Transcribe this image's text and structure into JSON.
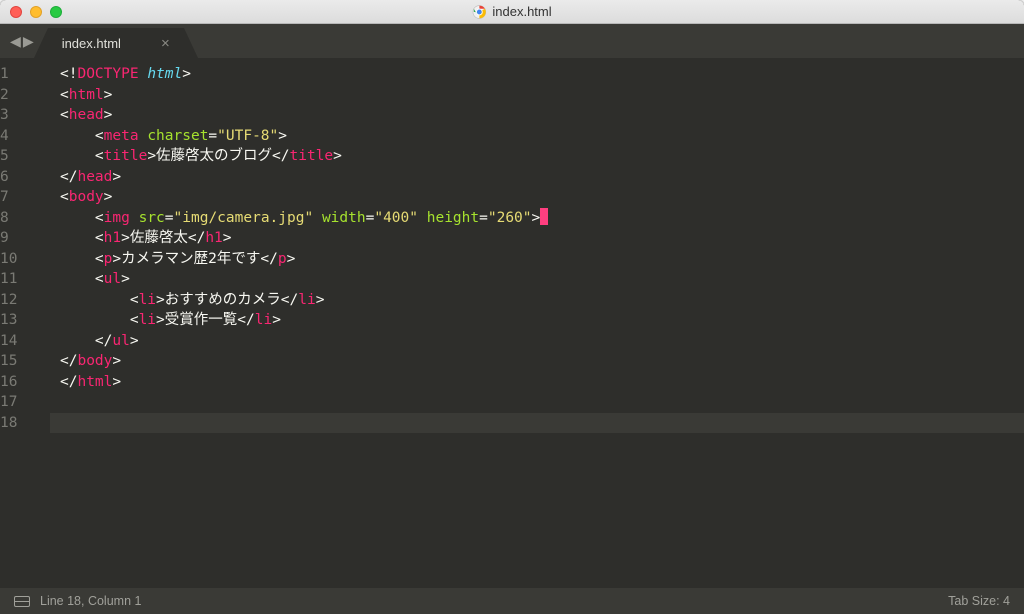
{
  "window": {
    "title": "index.html"
  },
  "tab": {
    "label": "index.html",
    "close": "×"
  },
  "nav": {
    "back": "◀",
    "forward": "▶"
  },
  "gutter": {
    "numbers": [
      "1",
      "2",
      "3",
      "4",
      "5",
      "6",
      "7",
      "8",
      "9",
      "10",
      "11",
      "12",
      "13",
      "14",
      "15",
      "16",
      "17",
      "18"
    ]
  },
  "code": {
    "lines": [
      {
        "indent": 0,
        "tokens": [
          [
            "w",
            "<!"
          ],
          [
            "doctype",
            "DOCTYPE"
          ],
          [
            "w",
            " "
          ],
          [
            "bl",
            "html"
          ],
          [
            "w",
            ">"
          ]
        ]
      },
      {
        "indent": 0,
        "tokens": [
          [
            "w",
            "<"
          ],
          [
            "p",
            "html"
          ],
          [
            "w",
            ">"
          ]
        ]
      },
      {
        "indent": 0,
        "tokens": [
          [
            "w",
            "<"
          ],
          [
            "p",
            "head"
          ],
          [
            "w",
            ">"
          ]
        ]
      },
      {
        "indent": 1,
        "tokens": [
          [
            "w",
            "<"
          ],
          [
            "p",
            "meta"
          ],
          [
            "w",
            " "
          ],
          [
            "a",
            "charset"
          ],
          [
            "w",
            "="
          ],
          [
            "s",
            "\"UTF-8\""
          ],
          [
            "w",
            ">"
          ]
        ]
      },
      {
        "indent": 1,
        "tokens": [
          [
            "w",
            "<"
          ],
          [
            "p",
            "title"
          ],
          [
            "w",
            ">"
          ],
          [
            "w",
            "佐藤啓太のブログ"
          ],
          [
            "w",
            "</"
          ],
          [
            "p",
            "title"
          ],
          [
            "w",
            ">"
          ]
        ]
      },
      {
        "indent": 0,
        "tokens": [
          [
            "w",
            "</"
          ],
          [
            "p",
            "head"
          ],
          [
            "w",
            ">"
          ]
        ]
      },
      {
        "indent": 0,
        "tokens": [
          [
            "w",
            "<"
          ],
          [
            "p",
            "body"
          ],
          [
            "w",
            ">"
          ]
        ]
      },
      {
        "indent": 1,
        "tokens": [
          [
            "w",
            "<"
          ],
          [
            "p",
            "img"
          ],
          [
            "w",
            " "
          ],
          [
            "a",
            "src"
          ],
          [
            "w",
            "="
          ],
          [
            "s",
            "\"img/camera.jpg\""
          ],
          [
            "w",
            " "
          ],
          [
            "a",
            "width"
          ],
          [
            "w",
            "="
          ],
          [
            "s",
            "\"400\""
          ],
          [
            "w",
            " "
          ],
          [
            "a",
            "height"
          ],
          [
            "w",
            "="
          ],
          [
            "s",
            "\"260\""
          ],
          [
            "w",
            ">"
          ]
        ],
        "cursor": true
      },
      {
        "indent": 1,
        "tokens": [
          [
            "w",
            "<"
          ],
          [
            "p",
            "h1"
          ],
          [
            "w",
            ">"
          ],
          [
            "w",
            "佐藤啓太"
          ],
          [
            "w",
            "</"
          ],
          [
            "p",
            "h1"
          ],
          [
            "w",
            ">"
          ]
        ]
      },
      {
        "indent": 1,
        "tokens": [
          [
            "w",
            "<"
          ],
          [
            "p",
            "p"
          ],
          [
            "w",
            ">"
          ],
          [
            "w",
            "カメラマン歴2年です"
          ],
          [
            "w",
            "</"
          ],
          [
            "p",
            "p"
          ],
          [
            "w",
            ">"
          ]
        ]
      },
      {
        "indent": 1,
        "tokens": [
          [
            "w",
            "<"
          ],
          [
            "p",
            "ul"
          ],
          [
            "w",
            ">"
          ]
        ]
      },
      {
        "indent": 2,
        "tokens": [
          [
            "w",
            "<"
          ],
          [
            "p",
            "li"
          ],
          [
            "w",
            ">"
          ],
          [
            "w",
            "おすすめのカメラ"
          ],
          [
            "w",
            "</"
          ],
          [
            "p",
            "li"
          ],
          [
            "w",
            ">"
          ]
        ]
      },
      {
        "indent": 2,
        "tokens": [
          [
            "w",
            "<"
          ],
          [
            "p",
            "li"
          ],
          [
            "w",
            ">"
          ],
          [
            "w",
            "受賞作一覧"
          ],
          [
            "w",
            "</"
          ],
          [
            "p",
            "li"
          ],
          [
            "w",
            ">"
          ]
        ]
      },
      {
        "indent": 1,
        "tokens": [
          [
            "w",
            "</"
          ],
          [
            "p",
            "ul"
          ],
          [
            "w",
            ">"
          ]
        ]
      },
      {
        "indent": 0,
        "tokens": [
          [
            "w",
            "</"
          ],
          [
            "p",
            "body"
          ],
          [
            "w",
            ">"
          ]
        ]
      },
      {
        "indent": 0,
        "tokens": [
          [
            "w",
            "</"
          ],
          [
            "p",
            "html"
          ],
          [
            "w",
            ">"
          ]
        ]
      },
      {
        "indent": 0,
        "tokens": []
      },
      {
        "indent": 0,
        "tokens": [],
        "active": true
      }
    ]
  },
  "status": {
    "pos": "Line 18, Column 1",
    "tab": "Tab Size: 4"
  }
}
